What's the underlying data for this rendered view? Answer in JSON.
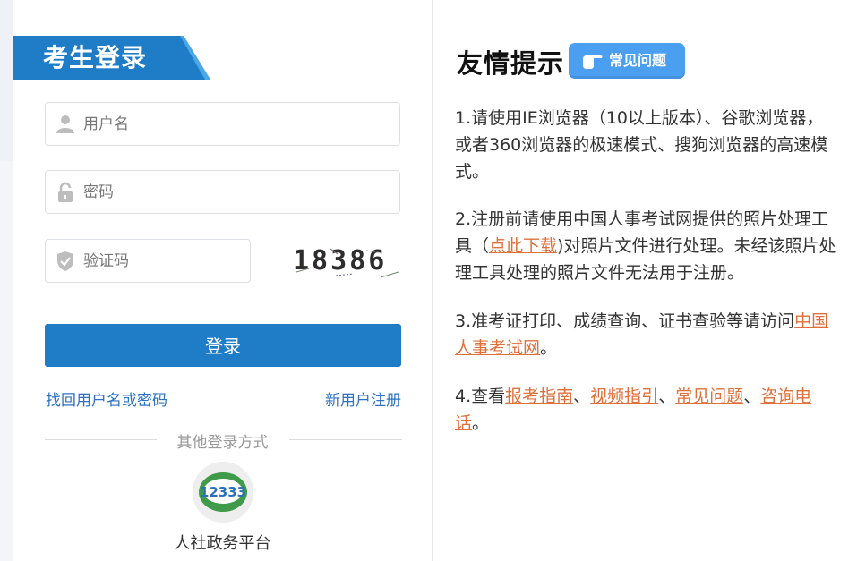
{
  "login": {
    "title": "考生登录",
    "username_placeholder": "用户名",
    "password_placeholder": "密码",
    "captcha_placeholder": "验证码",
    "captcha_code": "18386",
    "login_button": "登录",
    "forgot_link": "找回用户名或密码",
    "register_link": "新用户注册",
    "other_methods_label": "其他登录方式",
    "platform_label": "人社政务平台",
    "platform_logo_text": "12333"
  },
  "tips": {
    "title": "友情提示",
    "faq_badge": "常见问题",
    "tip1": "1.请使用IE浏览器（10以上版本）、谷歌浏览器，或者360浏览器的极速模式、搜狗浏览器的高速模式。",
    "tip2_before": "2.注册前请使用中国人事考试网提供的照片处理工具（",
    "tip2_link": "点此下载",
    "tip2_after": ")对照片文件进行处理。未经该照片处理工具处理的照片文件无法用于注册。",
    "tip3_before": "3.准考证打印、成绩查询、证书查验等请访问",
    "tip3_link": "中国人事考试网",
    "tip3_after": "。",
    "tip4_before": "4.查看",
    "tip4_link1": "报考指南",
    "tip4_sep1": "、",
    "tip4_link2": "视频指引",
    "tip4_sep2": "、",
    "tip4_link3": "常见问题",
    "tip4_sep3": "、",
    "tip4_link4": "咨询电话",
    "tip4_after": "。"
  },
  "colors": {
    "primary_blue": "#1f7cc7",
    "link_blue": "#2b73c2",
    "link_orange": "#e0703a",
    "badge_blue": "#4a9ff0"
  }
}
